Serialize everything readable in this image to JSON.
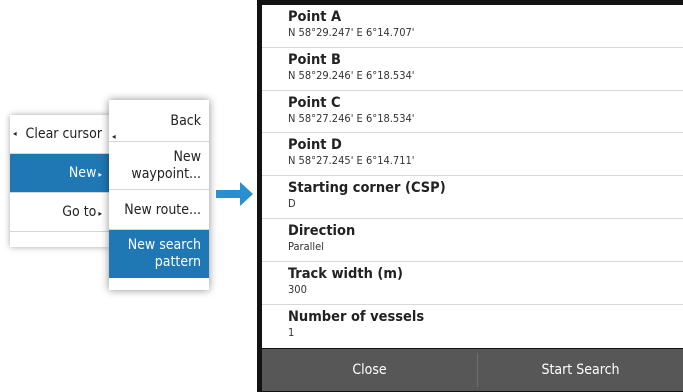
{
  "context_menu": {
    "items": [
      {
        "label": "Clear cursor"
      },
      {
        "label": "New"
      },
      {
        "label": "Go to"
      },
      {
        "label": ""
      }
    ]
  },
  "submenu": {
    "items": [
      {
        "label": "Back"
      },
      {
        "label": "New waypoint..."
      },
      {
        "label": "New route..."
      },
      {
        "label": "New search pattern"
      }
    ]
  },
  "panel": {
    "fields": [
      {
        "label": "Point A",
        "value": "N 58°29.247' E  6°14.707'"
      },
      {
        "label": "Point B",
        "value": "N 58°29.246' E  6°18.534'"
      },
      {
        "label": "Point C",
        "value": "N 58°27.246' E  6°18.534'"
      },
      {
        "label": "Point D",
        "value": "N 58°27.245' E  6°14.711'"
      },
      {
        "label": "Starting corner (CSP)",
        "value": "D"
      },
      {
        "label": "Direction",
        "value": "Parallel"
      },
      {
        "label": "Track width (m)",
        "value": "300"
      },
      {
        "label": "Number of vessels",
        "value": "1"
      }
    ],
    "footer": {
      "close_label": "Close",
      "start_label": "Start Search"
    }
  },
  "colors": {
    "accent": "#1f77b4",
    "footer_bg": "#575757",
    "frame": "#121212"
  }
}
